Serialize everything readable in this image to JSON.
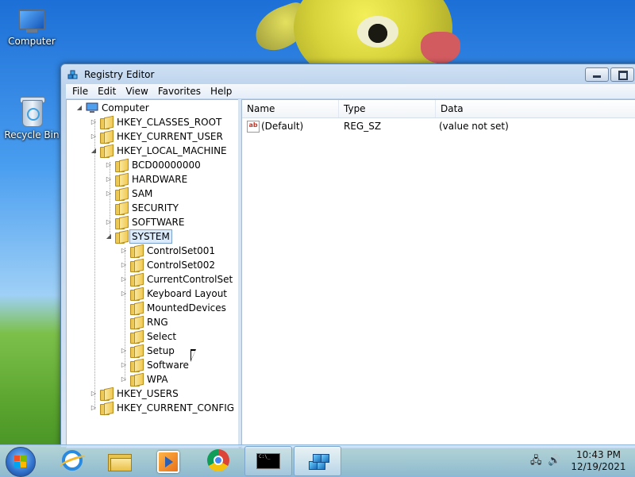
{
  "desktop": {
    "icons": [
      {
        "label": "Computer",
        "icon": "computer-icon"
      },
      {
        "label": "Recycle Bin",
        "icon": "recycle-bin-icon"
      }
    ]
  },
  "window": {
    "title": "Registry Editor",
    "icon": "registry-editor-icon",
    "menu": [
      "File",
      "Edit",
      "View",
      "Favorites",
      "Help"
    ]
  },
  "tree": {
    "root": "Computer",
    "nodes": [
      {
        "label": "HKEY_CLASSES_ROOT",
        "depth": 1,
        "expandable": true
      },
      {
        "label": "HKEY_CURRENT_USER",
        "depth": 1,
        "expandable": true
      },
      {
        "label": "HKEY_LOCAL_MACHINE",
        "depth": 1,
        "expanded": true
      },
      {
        "label": "BCD00000000",
        "depth": 2,
        "expandable": true
      },
      {
        "label": "HARDWARE",
        "depth": 2,
        "expandable": true
      },
      {
        "label": "SAM",
        "depth": 2,
        "expandable": true
      },
      {
        "label": "SECURITY",
        "depth": 2,
        "expandable": false
      },
      {
        "label": "SOFTWARE",
        "depth": 2,
        "expandable": true
      },
      {
        "label": "SYSTEM",
        "depth": 2,
        "expanded": true,
        "selected": true
      },
      {
        "label": "ControlSet001",
        "depth": 3,
        "expandable": true
      },
      {
        "label": "ControlSet002",
        "depth": 3,
        "expandable": true
      },
      {
        "label": "CurrentControlSet",
        "depth": 3,
        "expandable": true
      },
      {
        "label": "Keyboard Layout",
        "depth": 3,
        "expandable": true
      },
      {
        "label": "MountedDevices",
        "depth": 3,
        "expandable": false
      },
      {
        "label": "RNG",
        "depth": 3,
        "expandable": false
      },
      {
        "label": "Select",
        "depth": 3,
        "expandable": false
      },
      {
        "label": "Setup",
        "depth": 3,
        "expandable": true
      },
      {
        "label": "Software",
        "depth": 3,
        "expandable": true
      },
      {
        "label": "WPA",
        "depth": 3,
        "expandable": true
      },
      {
        "label": "HKEY_USERS",
        "depth": 1,
        "expandable": true
      },
      {
        "label": "HKEY_CURRENT_CONFIG",
        "depth": 1,
        "expandable": true
      }
    ]
  },
  "list": {
    "columns": [
      "Name",
      "Type",
      "Data"
    ],
    "rows": [
      {
        "name": "(Default)",
        "type": "REG_SZ",
        "data": "(value not set)",
        "icon": "string-value-icon"
      }
    ]
  },
  "taskbar": {
    "buttons": [
      {
        "name": "internet-explorer",
        "icon": "internet-explorer-icon"
      },
      {
        "name": "windows-explorer",
        "icon": "folder-icon"
      },
      {
        "name": "media-player",
        "icon": "media-player-icon"
      },
      {
        "name": "chrome",
        "icon": "chrome-icon"
      },
      {
        "name": "command-prompt",
        "icon": "command-prompt-icon",
        "state": "open",
        "glyph": "C:\\_"
      },
      {
        "name": "registry-editor",
        "icon": "registry-editor-icon",
        "state": "active"
      }
    ],
    "clock": {
      "time": "10:43 PM",
      "date": "12/19/2021"
    }
  }
}
